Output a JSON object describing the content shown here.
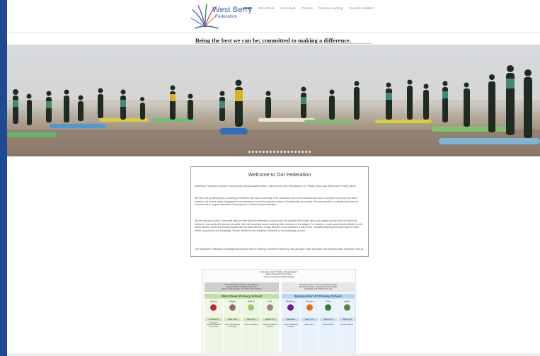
{
  "header": {
    "logo_name": "West Berry",
    "logo_sub": "Federation",
    "nav": [
      {
        "label": "HOME",
        "active": true
      },
      {
        "label": "Our School",
        "active": false
      },
      {
        "label": "Curriculum",
        "active": false
      },
      {
        "label": "Parents",
        "active": false
      },
      {
        "label": "Remote Learning",
        "active": false
      },
      {
        "label": "From the children!",
        "active": false
      }
    ],
    "tagline": "Being the best we can be; committed to making a difference."
  },
  "hero": {
    "slide_count": 18,
    "active_slide": 1
  },
  "welcome": {
    "title": "Welcome to Our Federation",
    "paragraphs": [
      "West Berry Federation consists of two primary schools situated within 6 miles of each other: Berrynarbor VC Primary School and West Down Primary school.",
      "We have one governing body consisting of members from each community. They contribute to our current success and help us continue to improve and move forwards. We have a senior management team working to ensure the smooth running of the federation as a whole. We work together to maintain high levels of communication, support standards of teaching and a wholly inclusive federation.",
      "We are very proud of the community spirit we have within the federation: both schools are situated within small, semi-rural villages and we strive to involve the children in community life wherever possible. We hold numerous events involving other members of the villages. For example, meals cooked by the children for the senior citizens, which is extremely popular with our local residents. A huge strength of our federation is that we are constantly learning and improving from each other's experiences and knowledge. We are excited by new initiatives and thrive on the challenges involved.",
      "The West Berry Federation encourages an inclusive style of teaching, we believe that every child can grow, thrive and enjoy their primary school experience with us."
    ]
  },
  "org_chart": {
    "head": [
      "Federation Head: Dr Daisy & Page Register",
      "Chair of Governors: Kim Kinner",
      "Clerk to Governors: Natalie Hosking"
    ],
    "left_box": [
      "Office Manager & Finance: Louise Sobanski",
      "Business Officer: SENDCo & PE Lead",
      "Admin: Jackie Rodgers, Amy Wolfe & Hannah Flint"
    ],
    "right_box": [
      "Site Team: Robert: Jean Lyons & Simon Wright",
      "Berrynarbor Kitchen: Clare Bowen & Tony Saffer",
      "Caretaking: Andi Willing & Tom Gall"
    ],
    "schools": [
      "West Down Primary School",
      "Berrynarbor VC Primary School"
    ],
    "classes": [
      {
        "name": "Cherry",
        "year": "Preschool & Reception",
        "color": "#c62828",
        "staff": "Teacher: Ben Brooke & Rachel Lipsha"
      },
      {
        "name": "Maple",
        "year": "Years 1 & 2",
        "color": "#8d6e63",
        "staff": "Teacher: Bo Anderson & Sue Armitage"
      },
      {
        "name": "Willow",
        "year": "Years 3 & 4",
        "color": "#9ccc65",
        "staff": "Teacher: Ivo Andrews"
      },
      {
        "name": "Oak",
        "year": "Years 5 & 6",
        "color": "#a1887f",
        "staff": "Teacher: Lucy Alford & Tina Russe"
      },
      {
        "name": "Mulberry",
        "year": "Reception",
        "color": "#6a1b9a",
        "staff": "Teacher: Belinda Hill & Kate Ames"
      },
      {
        "name": "Rowan",
        "year": "Years 1 & 2",
        "color": "#ef6c00",
        "staff": "Teacher: Jay Lin"
      },
      {
        "name": "Pine",
        "year": "Years 3 & 4",
        "color": "#2e7d32",
        "staff": "Teacher: Ian Short"
      },
      {
        "name": "Alder",
        "year": "Years 5 & 6",
        "color": "#558b2f",
        "staff": "Teacher: Dan Berry"
      }
    ]
  },
  "colors": {
    "page_border": "#1f4a93",
    "nav_active": "#233f7e",
    "west_down": "#bfe0a7",
    "berrynarbor": "#b6d7f0"
  }
}
